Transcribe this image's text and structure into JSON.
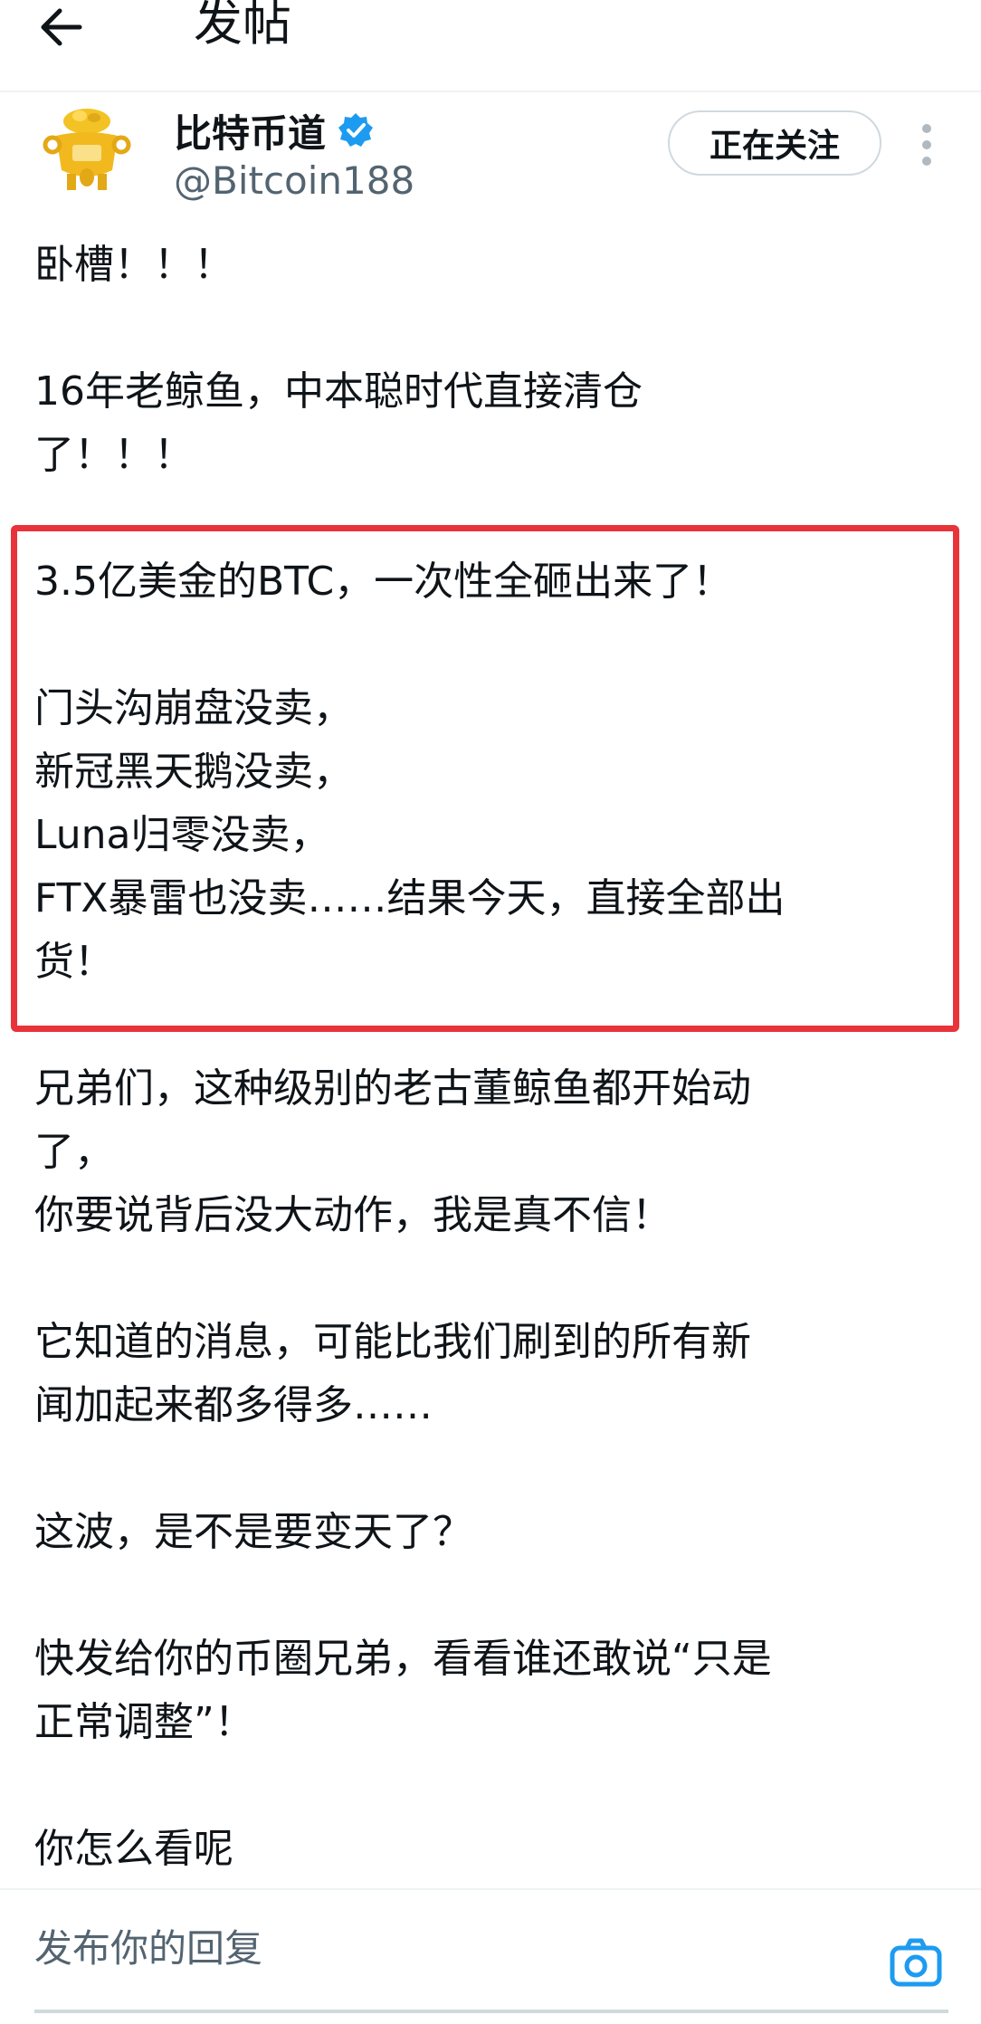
{
  "topbar": {
    "title": "发帖"
  },
  "author": {
    "display_name": "比特币道",
    "handle": "@Bitcoin188",
    "follow_label": "正在关注"
  },
  "post": {
    "paragraphs": [
      [
        "卧槽！！！"
      ],
      [
        "16年老鲸鱼，中本聪时代直接清仓",
        "了！！！"
      ],
      [
        "3.5亿美金的BTC，一次性全砸出来了！"
      ],
      [
        "门头沟崩盘没卖，",
        "新冠黑天鹅没卖，",
        "Luna归零没卖，",
        "FTX暴雷也没卖……结果今天，直接全部出",
        "货！"
      ],
      [
        "兄弟们，这种级别的老古董鲸鱼都开始动",
        "了，",
        "你要说背后没大动作，我是真不信！"
      ],
      [
        "它知道的消息，可能比我们刷到的所有新",
        "闻加起来都多得多……"
      ],
      [
        "这波，是不是要变天了？"
      ],
      [
        "快发给你的币圈兄弟，看看谁还敢说“只是",
        "正常调整”！"
      ],
      [
        "你怎么看呢"
      ]
    ]
  },
  "reply": {
    "placeholder": "发布你的回复"
  },
  "colors": {
    "highlight_border": "#e8333a",
    "verified_blue": "#1d9bf0",
    "secondary_text": "#536471"
  }
}
